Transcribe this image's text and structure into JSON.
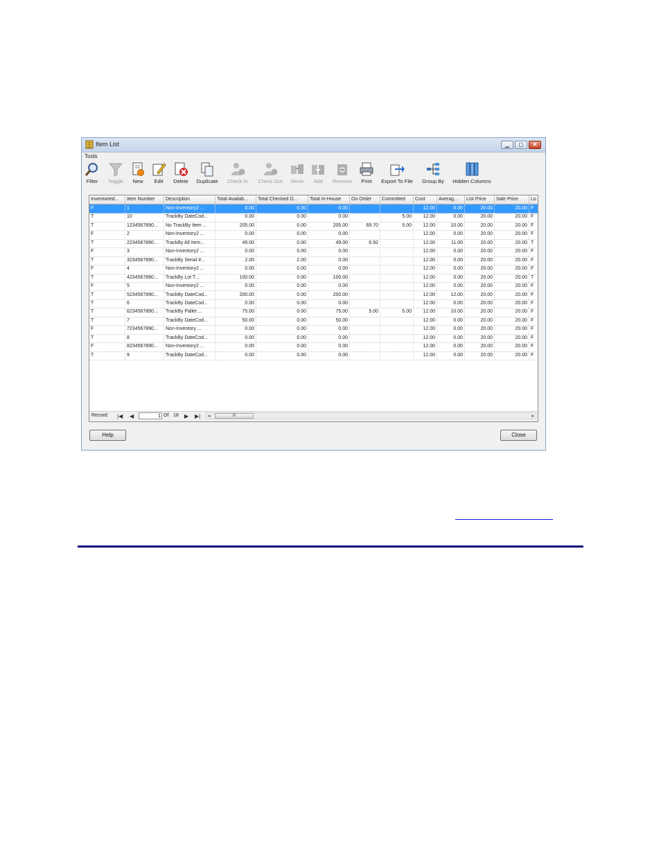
{
  "window": {
    "title": "Item List",
    "menu": "Tools",
    "min_label": "▁",
    "max_label": "▢",
    "close_label": "✕"
  },
  "toolbar": [
    {
      "label": "Filter",
      "icon": "magnifier-icon",
      "enabled": true
    },
    {
      "label": "Toggle",
      "icon": "funnel-icon",
      "enabled": false
    },
    {
      "label": "New",
      "icon": "new-document-icon",
      "enabled": true
    },
    {
      "label": "Edit",
      "icon": "edit-pencil-icon",
      "enabled": true
    },
    {
      "label": "Delete",
      "icon": "delete-x-icon",
      "enabled": true
    },
    {
      "label": "Duplicate",
      "icon": "duplicate-icon",
      "enabled": true
    },
    {
      "label": "Check In",
      "icon": "user-check-in-icon",
      "enabled": false
    },
    {
      "label": "Check Out",
      "icon": "user-check-out-icon",
      "enabled": false
    },
    {
      "label": "Move",
      "icon": "move-icon",
      "enabled": false
    },
    {
      "label": "Add",
      "icon": "add-icon",
      "enabled": false
    },
    {
      "label": "Remove",
      "icon": "remove-icon",
      "enabled": false
    },
    {
      "label": "Print",
      "icon": "printer-icon",
      "enabled": true
    },
    {
      "label": "Export To File",
      "icon": "export-icon",
      "enabled": true
    },
    {
      "label": "Group By",
      "icon": "group-by-icon",
      "enabled": true
    },
    {
      "label": "Hidden Columns",
      "icon": "hidden-columns-icon",
      "enabled": true
    }
  ],
  "grid": {
    "columns": [
      "Inventoried...",
      "Item Number",
      "Description",
      "Total Availab...",
      "Total Checked O...",
      "Total In-House",
      "On Order",
      "Committed",
      "Cost",
      "Averag...",
      "List Price",
      "Sale Price",
      "Lo"
    ],
    "rows": [
      [
        "F",
        "1",
        "Non-Inventory2 ...",
        "0.00",
        "0.00",
        "0.00",
        "",
        "",
        "12.00",
        "0.00",
        "20.00",
        "20.00",
        "F"
      ],
      [
        "T",
        "10",
        "TrackBy DateCod...",
        "0.00",
        "0.00",
        "0.00",
        "",
        "5.00",
        "12.00",
        "0.00",
        "20.00",
        "20.00",
        "F"
      ],
      [
        "T",
        "1234567890...",
        "No TrackBy Item ...",
        "205.00",
        "0.00",
        "205.00",
        "69.70",
        "5.00",
        "12.00",
        "10.00",
        "20.00",
        "20.00",
        "F"
      ],
      [
        "F",
        "2",
        "Non-Inventory2 ...",
        "0.00",
        "0.00",
        "0.00",
        "",
        "",
        "12.00",
        "0.00",
        "20.00",
        "20.00",
        "F"
      ],
      [
        "T",
        "2234567890...",
        "TrackBy All Item...",
        "49.00",
        "0.00",
        "49.00",
        "6.92",
        "",
        "12.00",
        "11.00",
        "20.00",
        "20.00",
        "T"
      ],
      [
        "F",
        "3",
        "Non-Inventory2 ...",
        "0.00",
        "0.00",
        "0.00",
        "",
        "",
        "12.00",
        "0.00",
        "20.00",
        "20.00",
        "F"
      ],
      [
        "T",
        "3234567890...",
        "TrackBy Serial #...",
        "2.00",
        "2.00",
        "0.00",
        "",
        "",
        "12.00",
        "0.00",
        "20.00",
        "20.00",
        "F"
      ],
      [
        "F",
        "4",
        "Non-Inventory2 ...",
        "0.00",
        "0.00",
        "0.00",
        "",
        "",
        "12.00",
        "0.00",
        "20.00",
        "20.00",
        "F"
      ],
      [
        "T",
        "4234567890...",
        "TrackBy Lot      T...",
        "100.00",
        "0.00",
        "100.00",
        "",
        "",
        "12.00",
        "0.00",
        "20.00",
        "20.00",
        "T"
      ],
      [
        "F",
        "5",
        "Non-Inventory2 ...",
        "0.00",
        "0.00",
        "0.00",
        "",
        "",
        "12.00",
        "0.00",
        "20.00",
        "20.00",
        "F"
      ],
      [
        "T",
        "5234567890...",
        "TrackBy DateCod...",
        "200.00",
        "0.00",
        "200.00",
        "",
        "",
        "12.00",
        "12.00",
        "20.00",
        "20.00",
        "F"
      ],
      [
        "T",
        "6",
        "TrackBy DateCod...",
        "0.00",
        "0.00",
        "0.00",
        "",
        "",
        "12.00",
        "0.00",
        "20.00",
        "20.00",
        "F"
      ],
      [
        "T",
        "6234567890...",
        "TrackBy Pallet ...",
        "75.00",
        "0.00",
        "75.00",
        "5.00",
        "5.00",
        "12.00",
        "10.00",
        "20.00",
        "20.00",
        "F"
      ],
      [
        "T",
        "7",
        "TrackBy DateCod...",
        "50.00",
        "0.00",
        "50.00",
        "",
        "",
        "12.00",
        "0.00",
        "20.00",
        "20.00",
        "F"
      ],
      [
        "F",
        "7234567890...",
        "Non-Inventory ...",
        "0.00",
        "0.00",
        "0.00",
        "",
        "",
        "12.00",
        "0.00",
        "20.00",
        "20.00",
        "F"
      ],
      [
        "T",
        "8",
        "TrackBy DateCod...",
        "0.00",
        "0.00",
        "0.00",
        "",
        "",
        "12.00",
        "0.00",
        "20.00",
        "20.00",
        "F"
      ],
      [
        "F",
        "8234567890...",
        "Non-Inventory2 ...",
        "0.00",
        "0.00",
        "0.00",
        "",
        "",
        "12.00",
        "0.00",
        "20.00",
        "20.00",
        "F"
      ],
      [
        "T",
        "9",
        "TrackBy DateCod...",
        "0.00",
        "0.00",
        "0.00",
        "",
        "",
        "12.00",
        "0.00",
        "20.00",
        "20.00",
        "F"
      ]
    ],
    "selected_row": 0
  },
  "navigator": {
    "record_label": "Record:",
    "current": "1",
    "of_label": "Of",
    "total": "18",
    "scroll_thumb": "III"
  },
  "buttons": {
    "help": "Help",
    "close": "Close"
  }
}
